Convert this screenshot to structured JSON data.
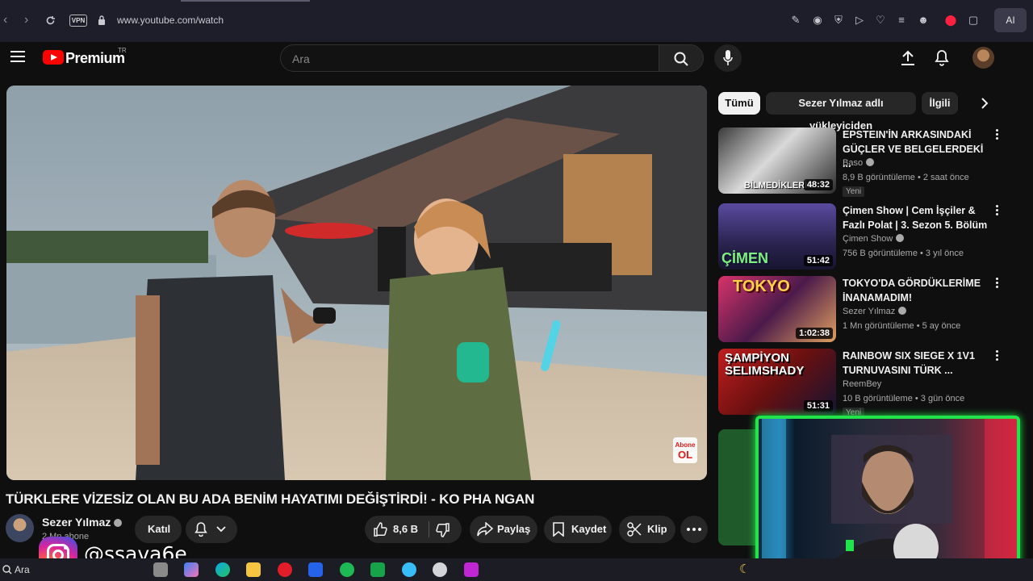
{
  "browser": {
    "url": "www.youtube.com/watch",
    "vpn_label": "VPN",
    "ai_label": "AI"
  },
  "header": {
    "logo_text": "Premium",
    "logo_country": "TR",
    "search_placeholder": "Ara"
  },
  "video": {
    "title": "TÜRKLERE VİZESİZ OLAN BU ADA BENİM HAYATIMI DEĞİŞTİRDİ! - KO PHA NGAN",
    "overlay_badge_top": "Abone",
    "overlay_badge_bottom": "OL"
  },
  "owner": {
    "channel_name": "Sezer Yılmaz",
    "subscribers": "2 Mn abone",
    "join_label": "Katıl"
  },
  "actions": {
    "likes": "8,6 B",
    "share_label": "Paylaş",
    "save_label": "Kaydet",
    "clip_label": "Klip"
  },
  "chips": [
    {
      "label": "Tümü",
      "active": true
    },
    {
      "label": "Sezer Yılmaz adlı yükleyiciden",
      "active": false
    },
    {
      "label": "İlgili",
      "active": false
    }
  ],
  "recommendations": [
    {
      "title": "EPSTEIN'İN ARKASINDAKİ GÜÇLER VE BELGELERDEKİ ...",
      "channel": "Baso",
      "meta": "8,9 B görüntüleme • 2 saat önce",
      "badge": "Yeni",
      "duration": "48:32",
      "thumb_caption": "BİLMEDİKLERİN",
      "thumb_colors": [
        "#2a2a2a",
        "#d9d9d9"
      ]
    },
    {
      "title": "Çimen Show | Cem İşçiler & Fazlı Polat | 3. Sezon 5. Bölüm",
      "channel": "Çimen Show",
      "meta": "756 B görüntüleme • 3 yıl önce",
      "badge": "",
      "duration": "51:42",
      "thumb_caption": "ÇİMEN",
      "thumb_colors": [
        "#4a3c8f",
        "#1d1a3a"
      ]
    },
    {
      "title": "TOKYO'DA GÖRDÜKLERİME İNANAMADIM!",
      "channel": "Sezer Yılmaz",
      "meta": "1 Mn görüntüleme • 5 ay önce",
      "badge": "",
      "duration": "1:02:38",
      "thumb_caption": "TOKYO",
      "thumb_colors": [
        "#c02a5a",
        "#2a1030"
      ]
    },
    {
      "title": "RAINBOW SIX SIEGE X 1V1 TURNUVASINI TÜRK ...",
      "channel": "ReemBey",
      "meta": "10 B görüntüleme • 3 gün önce",
      "badge": "Yeni",
      "duration": "51:31",
      "thumb_caption": "ŞAMPİYON SELIMSHADY",
      "thumb_colors": [
        "#b01c1c",
        "#1a1a3a"
      ]
    }
  ],
  "overlay": {
    "instagram_handle": "@ssava6e"
  },
  "taskbar": {
    "search_label": "Ara"
  },
  "colors": {
    "accent_red": "#ff0000",
    "webcam_frame": "#22e34a",
    "background": "#0f0f0f"
  }
}
